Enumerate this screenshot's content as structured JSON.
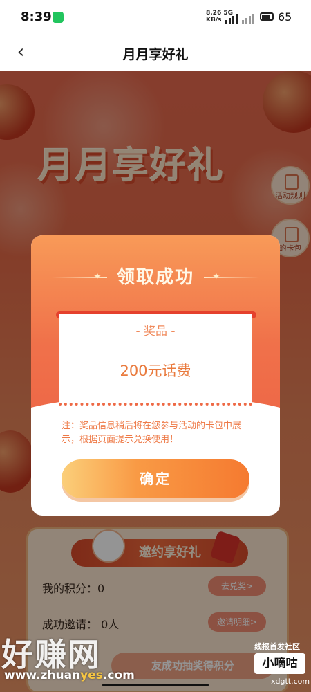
{
  "status_bar": {
    "time": "8:39",
    "network_speed": "8.26 5G",
    "network_unit": "KB/s",
    "battery_level": "65"
  },
  "nav": {
    "back_icon": "chevron-left-icon",
    "title": "月月享好礼"
  },
  "banner": {
    "title": "月月享好礼",
    "side_buttons": [
      {
        "label": "活动规则",
        "icon": "document-icon"
      },
      {
        "label": "的卡包",
        "icon": "card-icon"
      }
    ]
  },
  "modal": {
    "title": "领取成功",
    "prize_heading": "- 奖品 -",
    "prize_value": "200元话费",
    "note": "注：奖品信息稍后将在您参与活动的卡包中展示，根据页面提示兑换使用！",
    "confirm_label": "确定"
  },
  "invite_card": {
    "title": "邀约享好礼",
    "points_label": "我的积分：0",
    "points_button": "去兑奖>",
    "invites_label": "成功邀请：  0人",
    "invites_button": "邀请明细>",
    "bottom_button": "友成功抽奖得积分"
  },
  "watermarks": {
    "left_text": "好赚网",
    "left_url_prefix": "www.zhuan",
    "left_url_highlight": "yes",
    "left_url_suffix": ".com",
    "right_top": "线报首发社区",
    "right_box": "小嘀咕",
    "right_url": "xdgtt.com"
  }
}
